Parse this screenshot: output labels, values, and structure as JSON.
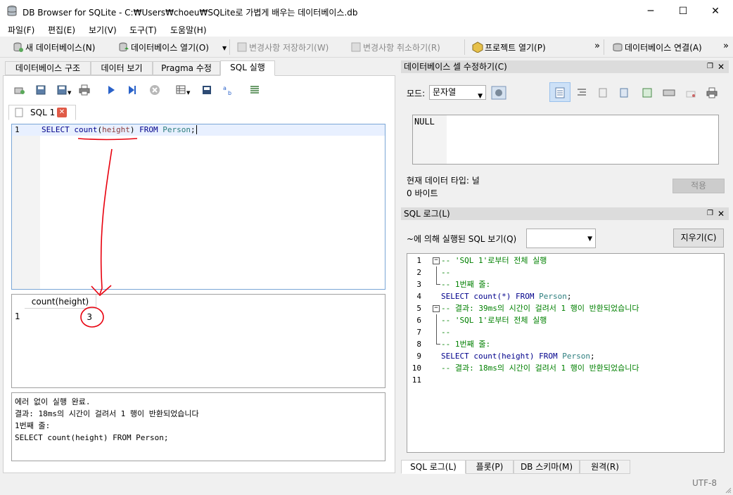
{
  "window": {
    "title": "DB Browser for SQLite - C:₩Users₩choeu₩SQLite로 가볍게 배우는 데이터베이스.db",
    "minimize": "─",
    "maximize": "☐",
    "close": "✕"
  },
  "menu": [
    "파일(F)",
    "편집(E)",
    "보기(V)",
    "도구(T)",
    "도움말(H)"
  ],
  "toolbar": {
    "new_db": "새 데이터베이스(N)",
    "open_db": "데이터베이스 열기(O)",
    "write_changes": "변경사항 저장하기(W)",
    "revert_changes": "변경사항 취소하기(R)",
    "open_project": "프로젝트 열기(P)",
    "attach_db": "데이터베이스 연결(A)",
    "overflow": "»"
  },
  "main_tabs": [
    "데이터베이스 구조",
    "데이터 보기",
    "Pragma 수정",
    "SQL 실행"
  ],
  "sql_tab": {
    "label": "SQL 1",
    "editor": {
      "line_number": "1",
      "code": {
        "kw1": "SELECT",
        "fn": "count",
        "arg_open": "(",
        "arg": "height",
        "arg_close": ")",
        "kw2": "FROM",
        "table": "Person",
        "end": ";"
      }
    },
    "results": {
      "column_header": "count(height)",
      "row_number": "1",
      "value": "3"
    },
    "message": [
      "에러 없이 실행 완료.",
      "결과: 18ms의 시간이 걸려서 1 행이 반환되었습니다",
      "1번째 줄:",
      "SELECT count(height) FROM Person;"
    ]
  },
  "edit_cell": {
    "title": "데이터베이스 셀 수정하기(C)",
    "mode_label": "모드:",
    "mode_value": "문자열",
    "cell_value": "NULL",
    "type_label": "현재 데이터 타입: 널",
    "size_label": "0 바이트",
    "apply": "적용"
  },
  "sql_log": {
    "title": "SQL 로그(L)",
    "submitted_label": "~에 의해 실행된 SQL 보기(Q)",
    "submitted_value": "",
    "clear": "지우기(C)",
    "lines": [
      {
        "n": "1",
        "t": "-- 'SQL 1'로부터 전체 실행",
        "kind": "cm",
        "fold": "box"
      },
      {
        "n": "2",
        "t": "--",
        "kind": "cm",
        "fold": "line"
      },
      {
        "n": "3",
        "t": "-- 1번째 줄:",
        "kind": "cm",
        "fold": "end"
      },
      {
        "n": "4",
        "t": "SELECT count(*) FROM Person;",
        "kind": "sql",
        "fold": ""
      },
      {
        "n": "5",
        "t": "-- 결과: 39ms의 시간이 걸려서 1 행이 반환되었습니다",
        "kind": "cm",
        "fold": "box"
      },
      {
        "n": "6",
        "t": "-- 'SQL 1'로부터 전체 실행",
        "kind": "cm",
        "fold": "line"
      },
      {
        "n": "7",
        "t": "--",
        "kind": "cm",
        "fold": "line"
      },
      {
        "n": "8",
        "t": "-- 1번째 줄:",
        "kind": "cm",
        "fold": "end"
      },
      {
        "n": "9",
        "t": "SELECT count(height) FROM Person;",
        "kind": "sql",
        "fold": ""
      },
      {
        "n": "10",
        "t": "-- 결과: 18ms의 시간이 걸려서 1 행이 반환되었습니다",
        "kind": "cm",
        "fold": ""
      },
      {
        "n": "11",
        "t": "",
        "kind": "cm",
        "fold": ""
      }
    ]
  },
  "bottom_tabs": [
    "SQL 로그(L)",
    "플롯(P)",
    "DB 스키마(M)",
    "원격(R)"
  ],
  "status": {
    "encoding": "UTF-8"
  },
  "annotation_color": "#e8000d"
}
